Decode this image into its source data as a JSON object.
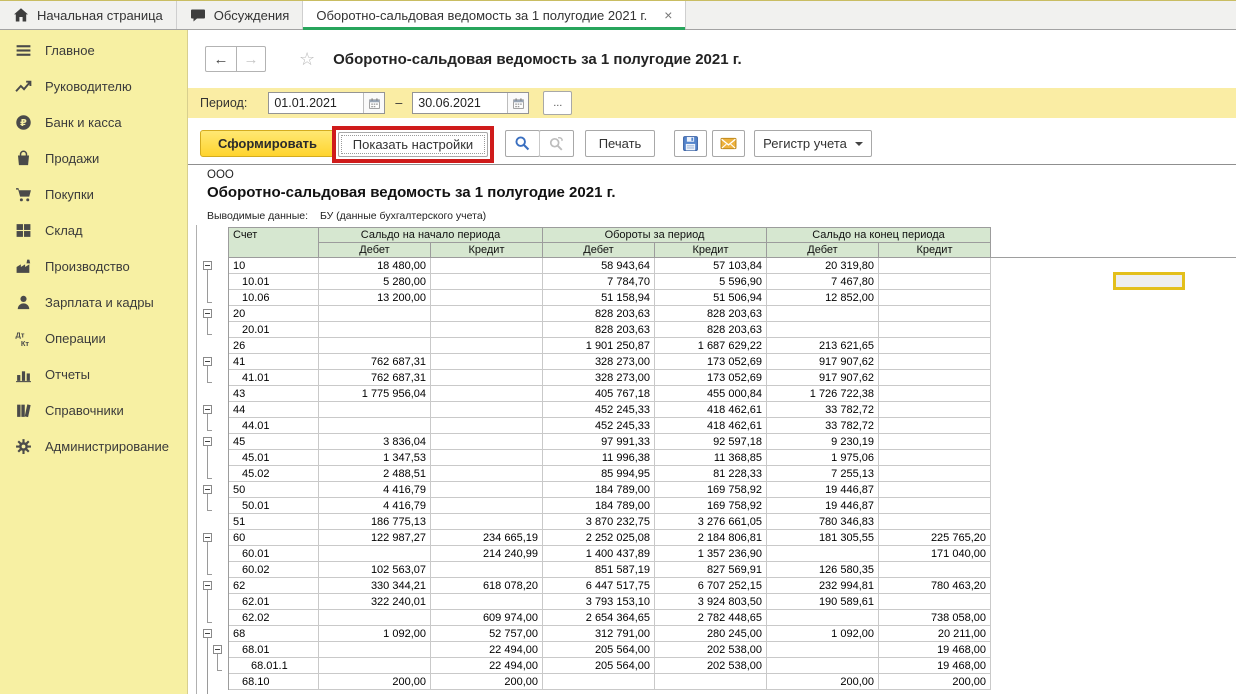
{
  "colors": {
    "accent_green": "#28a55c",
    "sidebar_bg": "#f7f0a3",
    "panel_yellow": "#faeda4",
    "button_yellow": "#ffd42e",
    "header_green": "#d6e7d0",
    "highlight_red": "#cf1b1b",
    "selection_yellow": "#e3bf1b"
  },
  "icons": {
    "back": "←",
    "forward": "→",
    "favorite": "☆",
    "ellipsis": "...",
    "close": "×"
  },
  "tabs": [
    {
      "id": "home",
      "icon": "home-icon",
      "label": "Начальная страница"
    },
    {
      "id": "discussions",
      "icon": "chat-icon",
      "label": "Обсуждения"
    },
    {
      "id": "report",
      "label": "Оборотно-сальдовая ведомость за 1 полугодие 2021 г.",
      "active": true,
      "close": "×"
    }
  ],
  "sidebar": {
    "items": [
      {
        "id": "main",
        "icon": "menu-icon",
        "label": "Главное"
      },
      {
        "id": "manager",
        "icon": "trend-icon",
        "label": "Руководителю"
      },
      {
        "id": "bank-cash",
        "icon": "ruble-icon",
        "label": "Банк и касса"
      },
      {
        "id": "sales",
        "icon": "bag-icon",
        "label": "Продажи"
      },
      {
        "id": "purchases",
        "icon": "cart-icon",
        "label": "Покупки"
      },
      {
        "id": "warehouse",
        "icon": "warehouse-icon",
        "label": "Склад"
      },
      {
        "id": "production",
        "icon": "factory-icon",
        "label": "Производство"
      },
      {
        "id": "payroll",
        "icon": "person-icon",
        "label": "Зарплата и кадры"
      },
      {
        "id": "operations",
        "icon": "dtkt-icon",
        "label": "Операции"
      },
      {
        "id": "reports",
        "icon": "chart-icon",
        "label": "Отчеты"
      },
      {
        "id": "directories",
        "icon": "books-icon",
        "label": "Справочники"
      },
      {
        "id": "administration",
        "icon": "gear-icon",
        "label": "Администрирование"
      }
    ]
  },
  "header": {
    "title": "Оборотно-сальдовая ведомость за 1 полугодие 2021 г."
  },
  "period": {
    "label": "Период:",
    "from": "01.01.2021",
    "dash": "–",
    "to": "30.06.2021"
  },
  "toolbar": {
    "generate_label": "Сформировать",
    "settings_label": "Показать настройки",
    "print_label": "Печать",
    "register_label": "Регистр учета"
  },
  "report": {
    "org": "ООО",
    "title": "Оборотно-сальдовая ведомость за 1 полугодие 2021 г.",
    "data_note_label": "Выводимые данные:",
    "data_note_value": "БУ (данные бухгалтерского учета)"
  },
  "table": {
    "corner_label": "Счет",
    "group_headers": [
      "Сальдо на начало периода",
      "Обороты за период",
      "Сальдо на конец периода"
    ],
    "debit_label": "Дебет",
    "credit_label": "Кредит",
    "rows": [
      {
        "account": "10",
        "level": 0,
        "expander": true,
        "values": [
          "18 480,00",
          "",
          "58 943,64",
          "57 103,84",
          "20 319,80",
          ""
        ]
      },
      {
        "account": "10.01",
        "level": 1,
        "values": [
          "5 280,00",
          "",
          "7 784,70",
          "5 596,90",
          "7 467,80",
          ""
        ]
      },
      {
        "account": "10.06",
        "level": 1,
        "values": [
          "13 200,00",
          "",
          "51 158,94",
          "51 506,94",
          "12 852,00",
          ""
        ]
      },
      {
        "account": "20",
        "level": 0,
        "expander": true,
        "values": [
          "",
          "",
          "828 203,63",
          "828 203,63",
          "",
          ""
        ]
      },
      {
        "account": "20.01",
        "level": 1,
        "values": [
          "",
          "",
          "828 203,63",
          "828 203,63",
          "",
          ""
        ]
      },
      {
        "account": "26",
        "level": 0,
        "values": [
          "",
          "",
          "1 901 250,87",
          "1 687 629,22",
          "213 621,65",
          ""
        ]
      },
      {
        "account": "41",
        "level": 0,
        "expander": true,
        "values": [
          "762 687,31",
          "",
          "328 273,00",
          "173 052,69",
          "917 907,62",
          ""
        ]
      },
      {
        "account": "41.01",
        "level": 1,
        "values": [
          "762 687,31",
          "",
          "328 273,00",
          "173 052,69",
          "917 907,62",
          ""
        ]
      },
      {
        "account": "43",
        "level": 0,
        "values": [
          "1 775 956,04",
          "",
          "405 767,18",
          "455 000,84",
          "1 726 722,38",
          ""
        ]
      },
      {
        "account": "44",
        "level": 0,
        "expander": true,
        "values": [
          "",
          "",
          "452 245,33",
          "418 462,61",
          "33 782,72",
          ""
        ]
      },
      {
        "account": "44.01",
        "level": 1,
        "values": [
          "",
          "",
          "452 245,33",
          "418 462,61",
          "33 782,72",
          ""
        ]
      },
      {
        "account": "45",
        "level": 0,
        "expander": true,
        "values": [
          "3 836,04",
          "",
          "97 991,33",
          "92 597,18",
          "9 230,19",
          ""
        ]
      },
      {
        "account": "45.01",
        "level": 1,
        "values": [
          "1 347,53",
          "",
          "11 996,38",
          "11 368,85",
          "1 975,06",
          ""
        ]
      },
      {
        "account": "45.02",
        "level": 1,
        "values": [
          "2 488,51",
          "",
          "85 994,95",
          "81 228,33",
          "7 255,13",
          ""
        ]
      },
      {
        "account": "50",
        "level": 0,
        "expander": true,
        "values": [
          "4 416,79",
          "",
          "184 789,00",
          "169 758,92",
          "19 446,87",
          ""
        ]
      },
      {
        "account": "50.01",
        "level": 1,
        "values": [
          "4 416,79",
          "",
          "184 789,00",
          "169 758,92",
          "19 446,87",
          ""
        ]
      },
      {
        "account": "51",
        "level": 0,
        "values": [
          "186 775,13",
          "",
          "3 870 232,75",
          "3 276 661,05",
          "780 346,83",
          ""
        ]
      },
      {
        "account": "60",
        "level": 0,
        "expander": true,
        "values": [
          "122 987,27",
          "234 665,19",
          "2 252 025,08",
          "2 184 806,81",
          "181 305,55",
          "225 765,20"
        ]
      },
      {
        "account": "60.01",
        "level": 1,
        "values": [
          "",
          "214 240,99",
          "1 400 437,89",
          "1 357 236,90",
          "",
          "171 040,00"
        ]
      },
      {
        "account": "60.02",
        "level": 1,
        "values": [
          "102 563,07",
          "",
          "851 587,19",
          "827 569,91",
          "126 580,35",
          ""
        ]
      },
      {
        "account": "62",
        "level": 0,
        "expander": true,
        "values": [
          "330 344,21",
          "618 078,20",
          "6 447 517,75",
          "6 707 252,15",
          "232 994,81",
          "780 463,20"
        ]
      },
      {
        "account": "62.01",
        "level": 1,
        "values": [
          "322 240,01",
          "",
          "3 793 153,10",
          "3 924 803,50",
          "190 589,61",
          ""
        ]
      },
      {
        "account": "62.02",
        "level": 1,
        "values": [
          "",
          "609 974,00",
          "2 654 364,65",
          "2 782 448,65",
          "",
          "738 058,00"
        ]
      },
      {
        "account": "68",
        "level": 0,
        "expander": true,
        "values": [
          "1 092,00",
          "52 757,00",
          "312 791,00",
          "280 245,00",
          "1 092,00",
          "20 211,00"
        ]
      },
      {
        "account": "68.01",
        "level": 1,
        "expander": true,
        "values": [
          "",
          "22 494,00",
          "205 564,00",
          "202 538,00",
          "",
          "19 468,00"
        ]
      },
      {
        "account": "68.01.1",
        "level": 2,
        "values": [
          "",
          "22 494,00",
          "205 564,00",
          "202 538,00",
          "",
          "19 468,00"
        ]
      },
      {
        "account": "68.10",
        "level": 1,
        "values": [
          "200,00",
          "200,00",
          "",
          "",
          "200,00",
          "200,00"
        ]
      }
    ]
  }
}
